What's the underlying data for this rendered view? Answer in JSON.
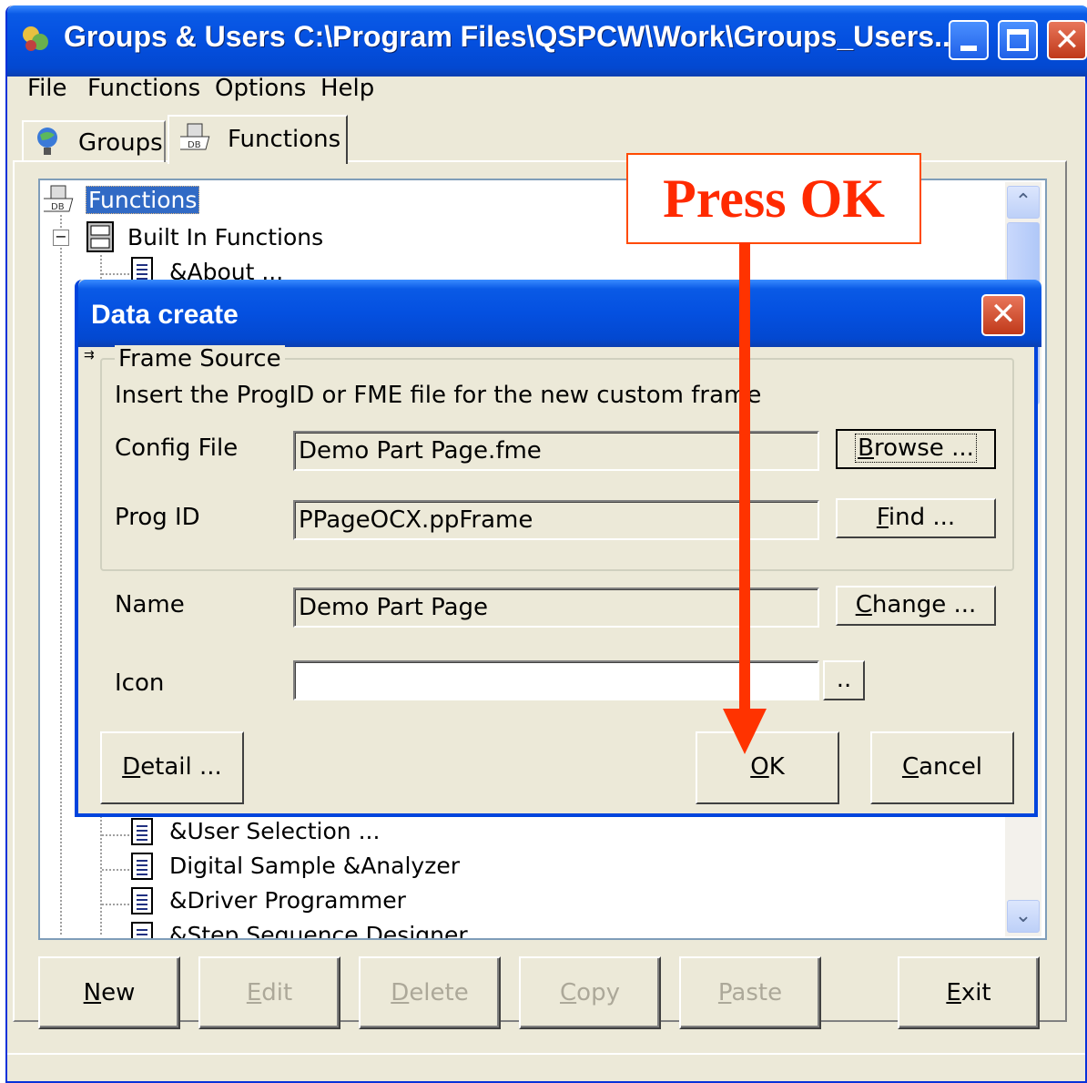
{
  "window": {
    "title": "Groups & Users C:\\Program Files\\QSPCW\\Work\\Groups_Users....",
    "colors": {
      "titlebar": "#0450e0",
      "face": "#ece9d8"
    }
  },
  "menu": [
    "File",
    "Functions",
    "Options",
    "Help"
  ],
  "tabs": [
    {
      "label": "Groups",
      "icon": "globe-user-icon"
    },
    {
      "label": "Functions",
      "icon": "functions-icon",
      "active": true
    }
  ],
  "tree": {
    "root": "Functions",
    "group": "Built In Functions",
    "items_above": [
      "&About ..."
    ],
    "items_below": [
      "&User Selection ...",
      "Digital Sample &Analyzer",
      "&Driver Programmer",
      "&Step Sequence Designer"
    ]
  },
  "buttons": {
    "new": {
      "pre": "",
      "key": "N",
      "post": "ew"
    },
    "edit": {
      "pre": "",
      "key": "E",
      "post": "dit"
    },
    "delete": {
      "pre": "",
      "key": "D",
      "post": "elete"
    },
    "copy": {
      "pre": "",
      "key": "C",
      "post": "opy"
    },
    "paste": {
      "pre": "",
      "key": "P",
      "post": "aste"
    },
    "exit": {
      "pre": "",
      "key": "E",
      "post": "xit"
    }
  },
  "dialog": {
    "title": "Data create",
    "frame_label": "Frame Source",
    "instruction": "Insert the ProgID or FME file for the new custom frame",
    "config_label": "Config File",
    "config_value": "Demo Part Page.fme",
    "browse": {
      "pre": "",
      "key": "B",
      "post": "rowse ..."
    },
    "progid_label": "Prog ID",
    "progid_value": "PPageOCX.ppFrame",
    "find": {
      "pre": "",
      "key": "F",
      "post": "ind ..."
    },
    "name_label": "Name",
    "name_value": "Demo Part Page",
    "change": {
      "pre": "",
      "key": "C",
      "post": "hange ..."
    },
    "icon_label": "Icon",
    "icon_value": "",
    "icon_browse": "..",
    "detail": {
      "pre": "",
      "key": "D",
      "post": "etail ..."
    },
    "ok": {
      "pre": "",
      "key": "O",
      "post": "K"
    },
    "cancel": {
      "pre": "",
      "key": "C",
      "post": "ancel"
    }
  },
  "annotation": {
    "text": "Press OK",
    "color": "#ff3300"
  }
}
